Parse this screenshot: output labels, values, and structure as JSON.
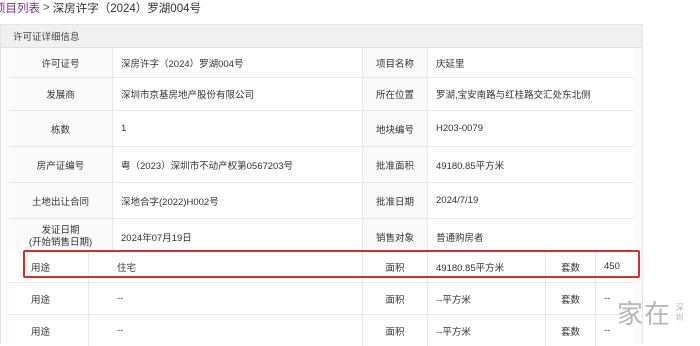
{
  "breadcrumb": {
    "parent": "项目列表",
    "separator": ">",
    "current": "深房许字（2024）罗湖004号"
  },
  "panel": {
    "title": "许可证详细信息"
  },
  "info_rows": [
    {
      "label_left": "许可证号",
      "value_left": "深房许字（2024）罗湖004号",
      "label_right": "项目名称",
      "value_right": "庆延里"
    },
    {
      "label_left": "发展商",
      "value_left": "深圳市京基房地产股份有限公司",
      "label_right": "所在位置",
      "value_right": "罗湖,宝安南路与红桂路交汇处东北侧"
    },
    {
      "label_left": "栋数",
      "value_left": "1",
      "label_right": "地块编号",
      "value_right": "H203-0079"
    },
    {
      "label_left": "房产证编号",
      "value_left": "粤（2023）深圳市不动产权第0567203号",
      "label_right": "批准面积",
      "value_right": "49180.85平方米"
    },
    {
      "label_left": "土地出让合同",
      "value_left": "深地合字(2022)H002号",
      "label_right": "批准日期",
      "value_right": "2024/7/19"
    },
    {
      "label_left_line1": "发证日期",
      "label_left_line2": "(开始销售日期)",
      "value_left": "2024年07月19日",
      "label_right": "销售对象",
      "value_right": "普通购房者"
    }
  ],
  "use_rows": [
    {
      "use_label": "用途",
      "use_value": "住宅",
      "area_label": "面积",
      "area_value": "49180.85平方米",
      "sets_label": "套数",
      "sets_value": "450"
    },
    {
      "use_label": "用途",
      "use_value": "--",
      "area_label": "面积",
      "area_value": "--平方米",
      "sets_label": "套数",
      "sets_value": "--"
    },
    {
      "use_label": "用途",
      "use_value": "--",
      "area_label": "面积",
      "area_value": "--平方米",
      "sets_label": "套数",
      "sets_value": "--"
    }
  ],
  "watermark": {
    "main": "家在",
    "side": "深圳"
  },
  "colors": {
    "link": "#7a2e8c",
    "highlight": "#d0302d",
    "header_bg": "#f0f0f0"
  }
}
